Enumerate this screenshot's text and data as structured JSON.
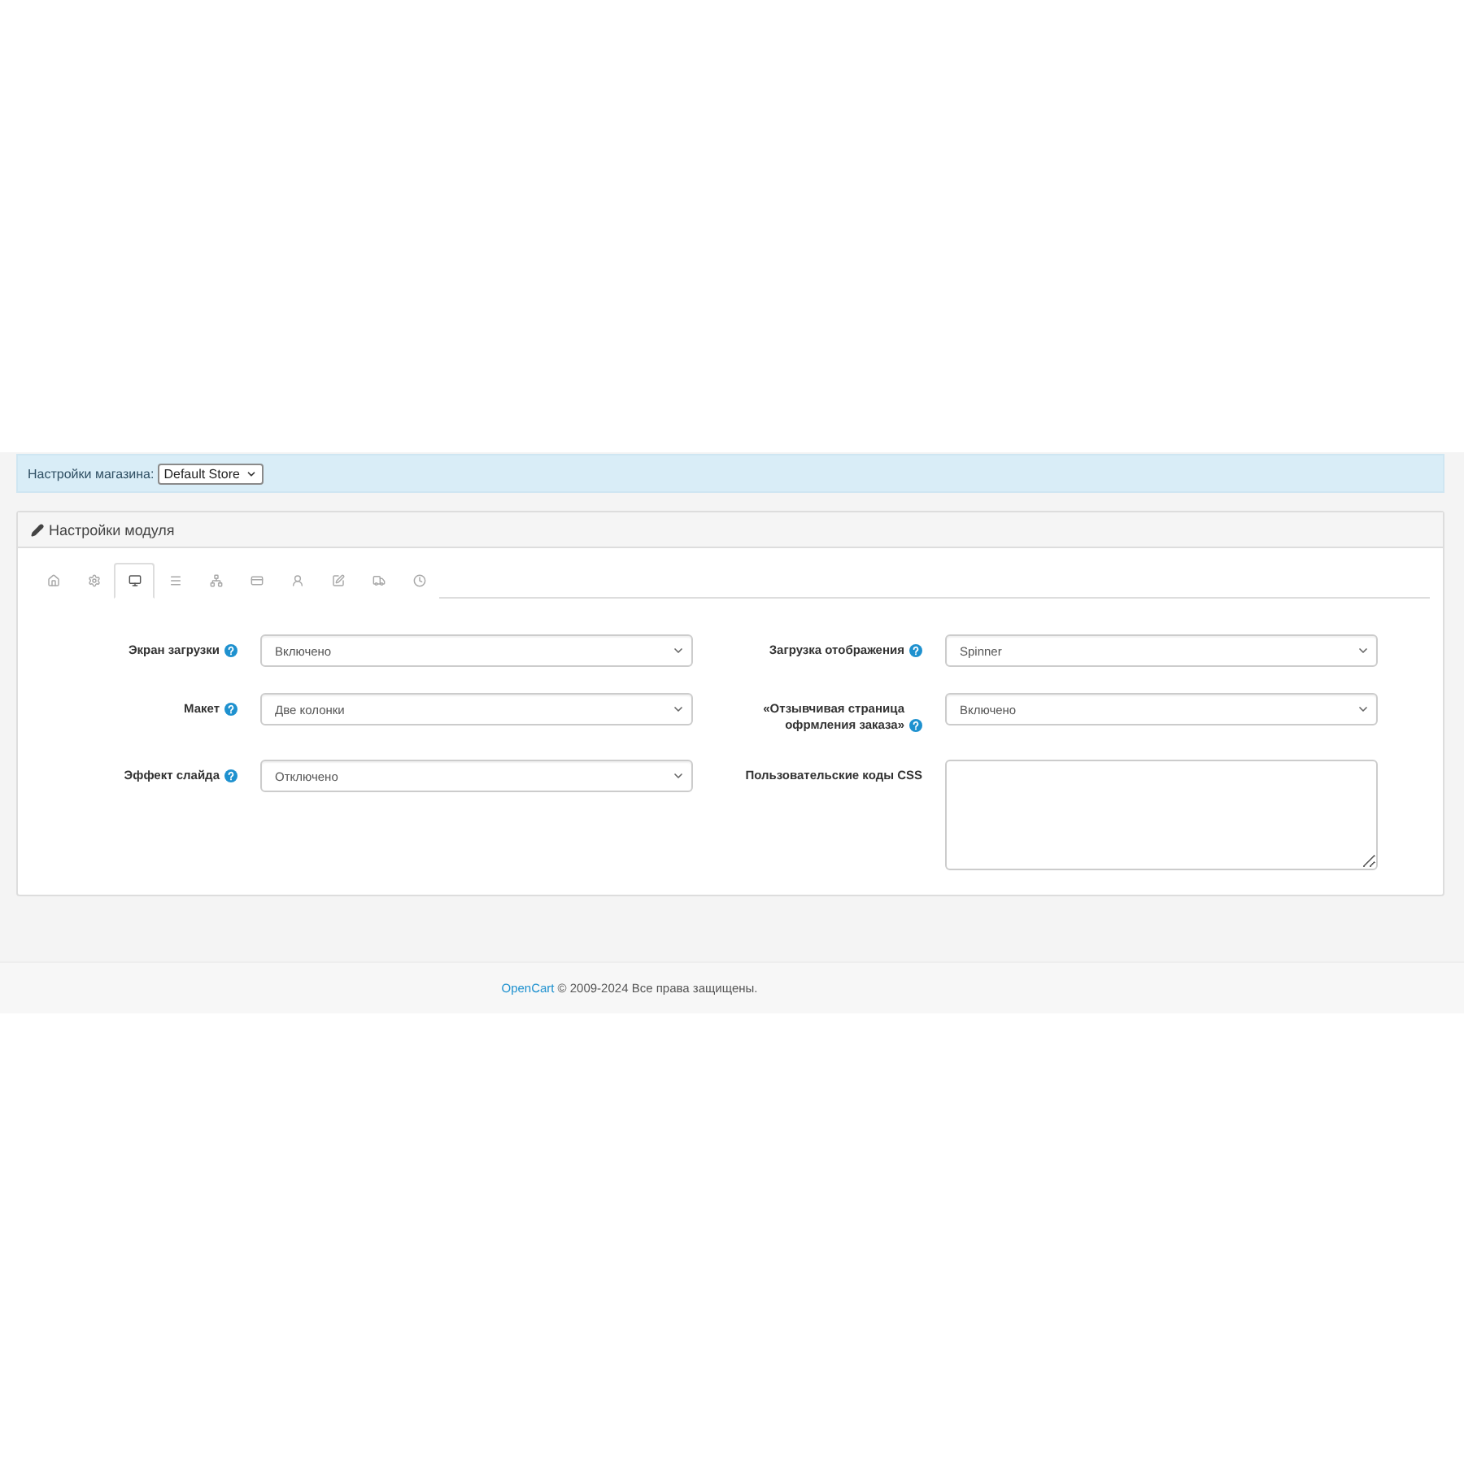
{
  "store_bar": {
    "label": "Настройки магазина:",
    "store": "Default Store"
  },
  "panel": {
    "title": "Настройки модуля",
    "tabs": [
      {
        "selected": false
      },
      {
        "selected": false
      },
      {
        "selected": true
      },
      {
        "selected": false
      },
      {
        "selected": false
      },
      {
        "selected": false
      },
      {
        "selected": false
      },
      {
        "selected": false
      },
      {
        "selected": false
      },
      {
        "selected": false
      }
    ],
    "rows": [
      {
        "left": {
          "label": "Экран загрузки",
          "help": true,
          "kind": "select",
          "value": "Включено"
        },
        "right": {
          "label": "Загрузка отображения",
          "help": true,
          "kind": "select",
          "value": "Spinner"
        }
      },
      {
        "left": {
          "label": "Макет",
          "help": true,
          "kind": "select",
          "value": "Две колонки"
        },
        "right": {
          "label": "«Отзывчивая страница офрмления заказа»",
          "help": true,
          "kind": "select",
          "value": "Включено"
        }
      },
      {
        "left": {
          "label": "Эффект слайда",
          "help": true,
          "kind": "select",
          "value": "Отключено"
        },
        "right": {
          "label": "Пользовательские коды CSS",
          "help": false,
          "kind": "textarea"
        }
      }
    ]
  },
  "footer": {
    "link": "OpenCart",
    "text": "© 2009-2024 Все права защищены."
  }
}
